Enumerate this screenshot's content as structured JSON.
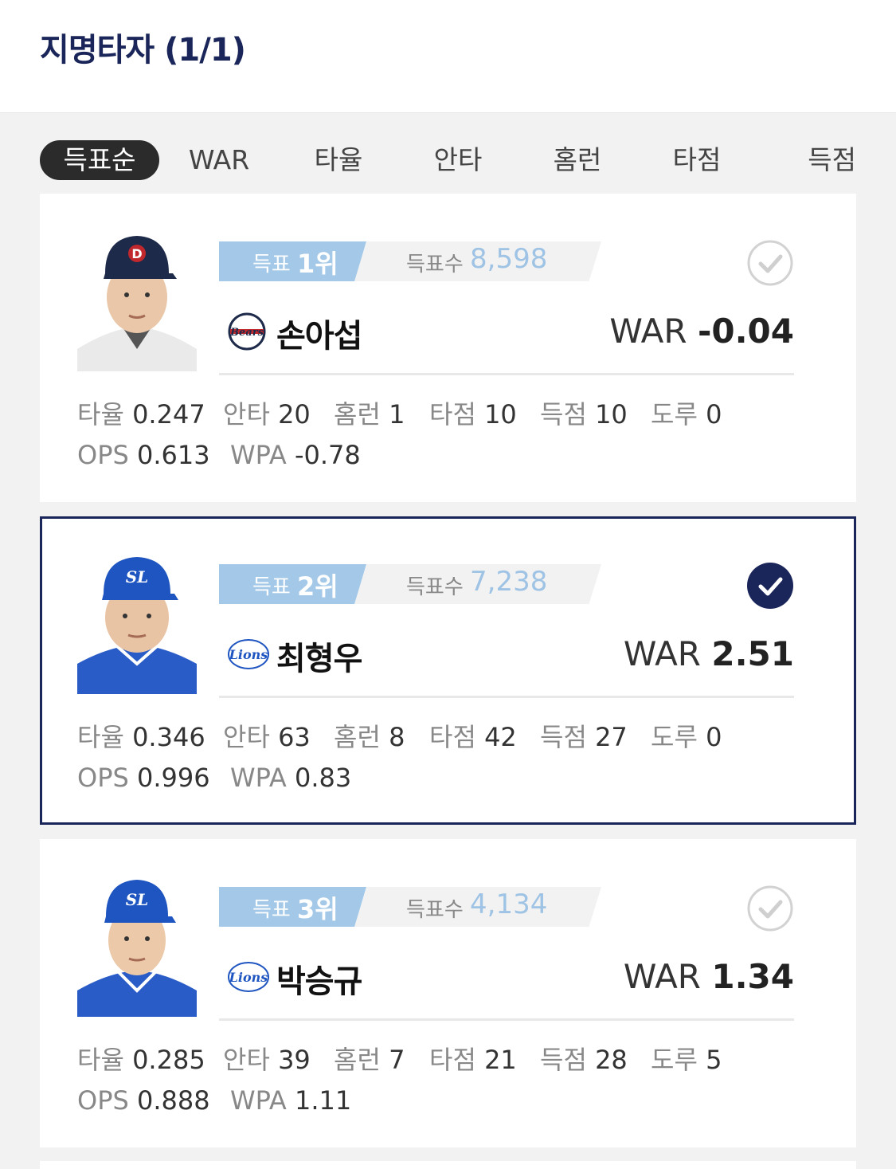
{
  "header": {
    "title": "지명타자 (1/1)"
  },
  "tabs": [
    "득표순",
    "WAR",
    "타율",
    "안타",
    "홈런",
    "타점",
    "득점"
  ],
  "active_tab": 0,
  "labels": {
    "rank": "득표",
    "votes": "득표수",
    "war": "WAR",
    "avg": "타율",
    "hits": "안타",
    "hr": "홈런",
    "rbi": "타점",
    "runs": "득점",
    "sb": "도루",
    "ops": "OPS",
    "wpa": "WPA"
  },
  "players": [
    {
      "rank": "1위",
      "votes": "8,598",
      "name": "손아섭",
      "team": "bears-logo",
      "war": "-0.04",
      "avg": "0.247",
      "hits": "20",
      "hr": "1",
      "rbi": "10",
      "runs": "10",
      "sb": "0",
      "ops": "0.613",
      "wpa": "-0.78",
      "selected": false,
      "cap_color": "#1e2a4a"
    },
    {
      "rank": "2위",
      "votes": "7,238",
      "name": "최형우",
      "team": "lions-logo",
      "war": "2.51",
      "avg": "0.346",
      "hits": "63",
      "hr": "8",
      "rbi": "42",
      "runs": "27",
      "sb": "0",
      "ops": "0.996",
      "wpa": "0.83",
      "selected": true,
      "cap_color": "#1f55c0"
    },
    {
      "rank": "3위",
      "votes": "4,134",
      "name": "박승규",
      "team": "lions-logo",
      "war": "1.34",
      "avg": "0.285",
      "hits": "39",
      "hr": "7",
      "rbi": "21",
      "runs": "28",
      "sb": "5",
      "ops": "0.888",
      "wpa": "1.11",
      "selected": false,
      "cap_color": "#1f55c0"
    }
  ],
  "colors": {
    "navy": "#1a2559",
    "rank_blue": "#a4c9e8",
    "votes_blue": "#9ec3e4"
  }
}
